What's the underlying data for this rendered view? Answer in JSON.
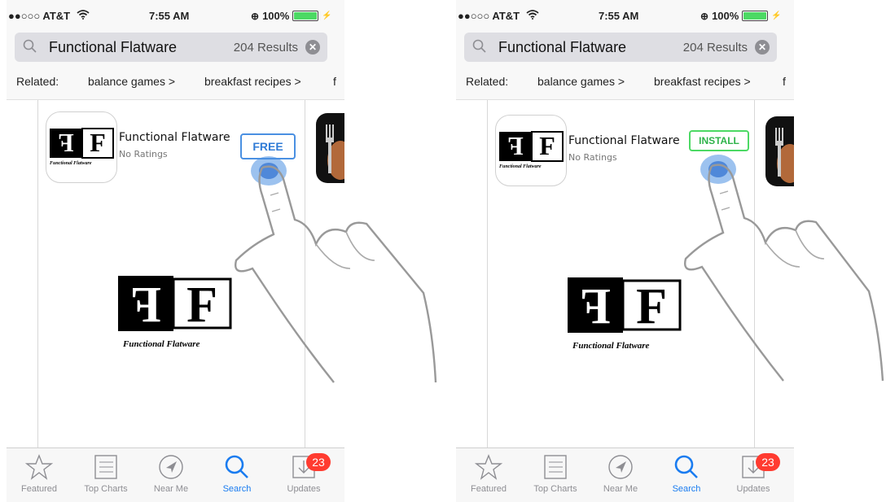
{
  "screens": [
    {
      "status": {
        "carrier": "●●○○○ AT&T",
        "wifi": "wifi-icon",
        "time": "7:55 AM",
        "battery_text": "100%",
        "battery_level": 1.0
      },
      "search": {
        "query": "Functional Flatware",
        "result_count": "204 Results",
        "clear": "clear-icon"
      },
      "related": {
        "label": "Related:",
        "items": [
          "balance games >",
          "breakfast recipes >",
          "f"
        ]
      },
      "app": {
        "name": "Functional Flatware",
        "ratings": "No Ratings",
        "button_label": "FREE",
        "logo_caption": "Functional Flatware"
      },
      "tabs": [
        {
          "label": "Featured",
          "icon": "star-icon"
        },
        {
          "label": "Top Charts",
          "icon": "list-icon"
        },
        {
          "label": "Near Me",
          "icon": "location-arrow-icon"
        },
        {
          "label": "Search",
          "icon": "search-icon",
          "active": true
        },
        {
          "label": "Updates",
          "icon": "download-icon",
          "badge": "23"
        }
      ]
    },
    {
      "status": {
        "carrier": "●●○○○ AT&T",
        "wifi": "wifi-icon",
        "time": "7:55 AM",
        "battery_text": "100%",
        "battery_level": 1.0
      },
      "search": {
        "query": "Functional Flatware",
        "result_count": "204 Results",
        "clear": "clear-icon"
      },
      "related": {
        "label": "Related:",
        "items": [
          "balance games >",
          "breakfast recipes >",
          "f"
        ]
      },
      "app": {
        "name": "Functional Flatware",
        "ratings": "No Ratings",
        "button_label": "INSTALL",
        "logo_caption": "Functional Flatware"
      },
      "tabs": [
        {
          "label": "Featured",
          "icon": "star-icon"
        },
        {
          "label": "Top Charts",
          "icon": "list-icon"
        },
        {
          "label": "Near Me",
          "icon": "location-arrow-icon"
        },
        {
          "label": "Search",
          "icon": "search-icon",
          "active": true
        },
        {
          "label": "Updates",
          "icon": "download-icon",
          "badge": "23"
        }
      ]
    }
  ],
  "colors": {
    "accent": "#1a7cf0",
    "free_border": "#4a90e2",
    "install_border": "#4cd964",
    "badge": "#ff3b30",
    "battery": "#4cd964"
  }
}
